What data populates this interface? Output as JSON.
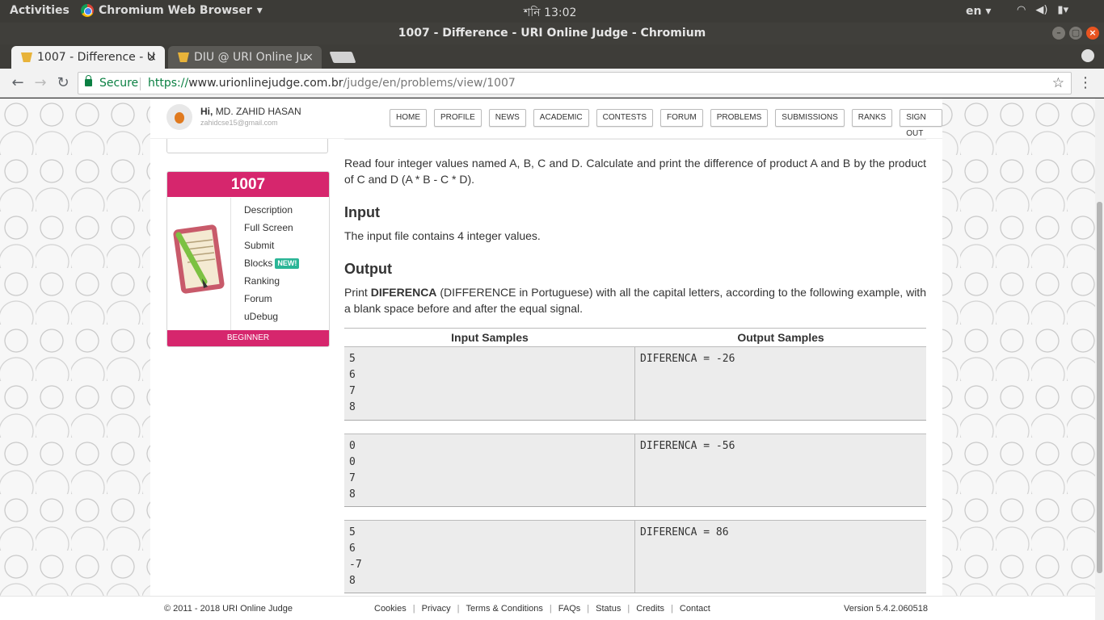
{
  "desktop": {
    "activities": "Activities",
    "app_name": "Chromium Web Browser",
    "clock": "শনি 13:02",
    "lang": "en"
  },
  "window": {
    "title": "1007 - Difference - URI Online Judge - Chromium"
  },
  "tabs": [
    {
      "label": "1007 - Difference - U"
    },
    {
      "label": "DIU @ URI Online Ju"
    }
  ],
  "toolbar": {
    "secure_label": "Secure",
    "url_scheme": "https://",
    "url_host": "www.urionlinejudge.com.br",
    "url_path": "/judge/en/problems/view/1007"
  },
  "header": {
    "greeting": "Hi,",
    "user_name": "MD. ZAHID HASAN",
    "email": "zahidcse15@gmail.com",
    "nav": [
      "HOME",
      "PROFILE",
      "NEWS",
      "ACADEMIC",
      "CONTESTS",
      "FORUM",
      "PROBLEMS",
      "SUBMISSIONS",
      "RANKS",
      "SIGN OUT"
    ]
  },
  "sidebar": {
    "problem_id": "1007",
    "links": [
      "Description",
      "Full Screen",
      "Submit",
      "Blocks",
      "Ranking",
      "Forum",
      "uDebug"
    ],
    "new_badge": "NEW!",
    "level": "BEGINNER"
  },
  "problem": {
    "description": "Read four integer values named A, B, C and D. Calculate and print the difference of product A and B by the product of C and D (A * B - C * D).",
    "input_heading": "Input",
    "input_text": "The input file contains 4 integer values.",
    "output_heading": "Output",
    "output_prefix": "Print ",
    "output_bold": "DIFERENCA",
    "output_rest": " (DIFFERENCE in Portuguese) with all the capital letters, according to the following example, with a blank space before and after the equal signal.",
    "samples_header": [
      "Input Samples",
      "Output Samples"
    ],
    "samples": [
      {
        "input": "5\n6\n7\n8",
        "output": "DIFERENCA = -26"
      },
      {
        "input": "0\n0\n7\n8",
        "output": "DIFERENCA = -56"
      },
      {
        "input": "5\n6\n-7\n8",
        "output": "DIFERENCA = 86"
      }
    ]
  },
  "footer": {
    "copyright": "© 2011 - 2018 URI Online Judge",
    "links": [
      "Cookies",
      "Privacy",
      "Terms & Conditions",
      "FAQs",
      "Status",
      "Credits",
      "Contact"
    ],
    "version": "Version 5.4.2.060518"
  }
}
